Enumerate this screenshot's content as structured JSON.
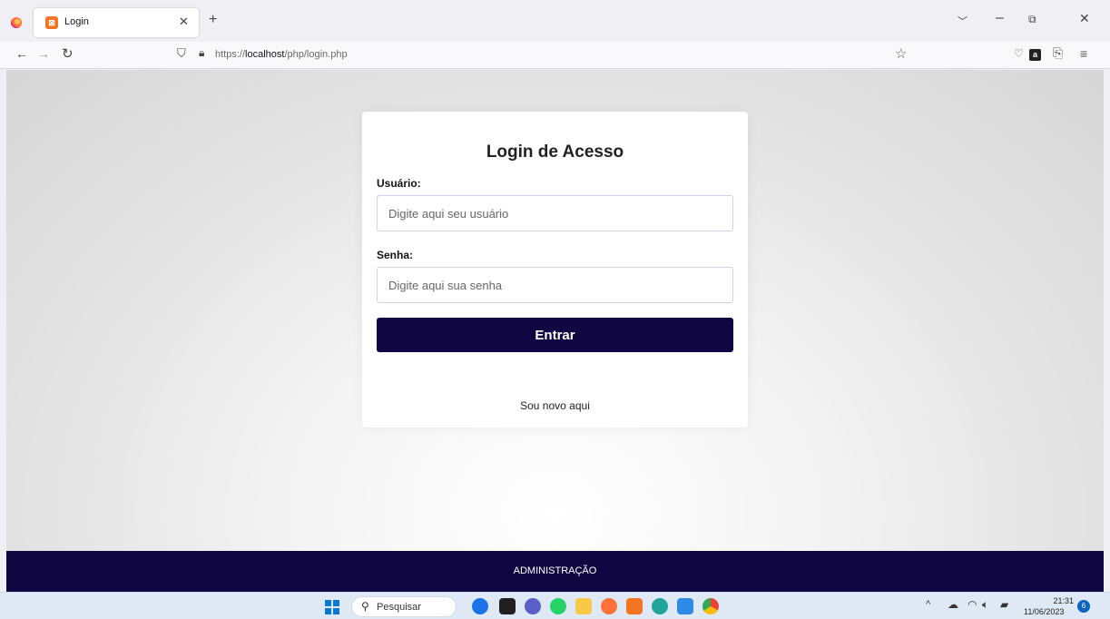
{
  "browser": {
    "tab": {
      "title": "Login",
      "favicon": "xampp-icon"
    },
    "url": {
      "prefix": "https://",
      "host": "localhost",
      "path": "/php/login.php"
    }
  },
  "page": {
    "title": "Login de Acesso",
    "username": {
      "label": "Usuário:",
      "placeholder": "Digite aqui seu usuário"
    },
    "password": {
      "label": "Senha:",
      "placeholder": "Digite aqui sua senha"
    },
    "submit_label": "Entrar",
    "signup_link": "Sou novo aqui",
    "footer": "ADMINISTRAÇÃO",
    "colors": {
      "primary": "#100641"
    }
  },
  "taskbar": {
    "search_placeholder": "Pesquisar",
    "apps": [
      "bing-chat-icon",
      "files-icon",
      "teams-icon",
      "whatsapp-icon",
      "file-explorer-icon",
      "firefox-icon",
      "xampp-icon",
      "edge-icon",
      "store-icon",
      "chrome-icon"
    ],
    "clock": {
      "time": "21:31",
      "date": "11/06/2023"
    },
    "notifications": "6"
  }
}
